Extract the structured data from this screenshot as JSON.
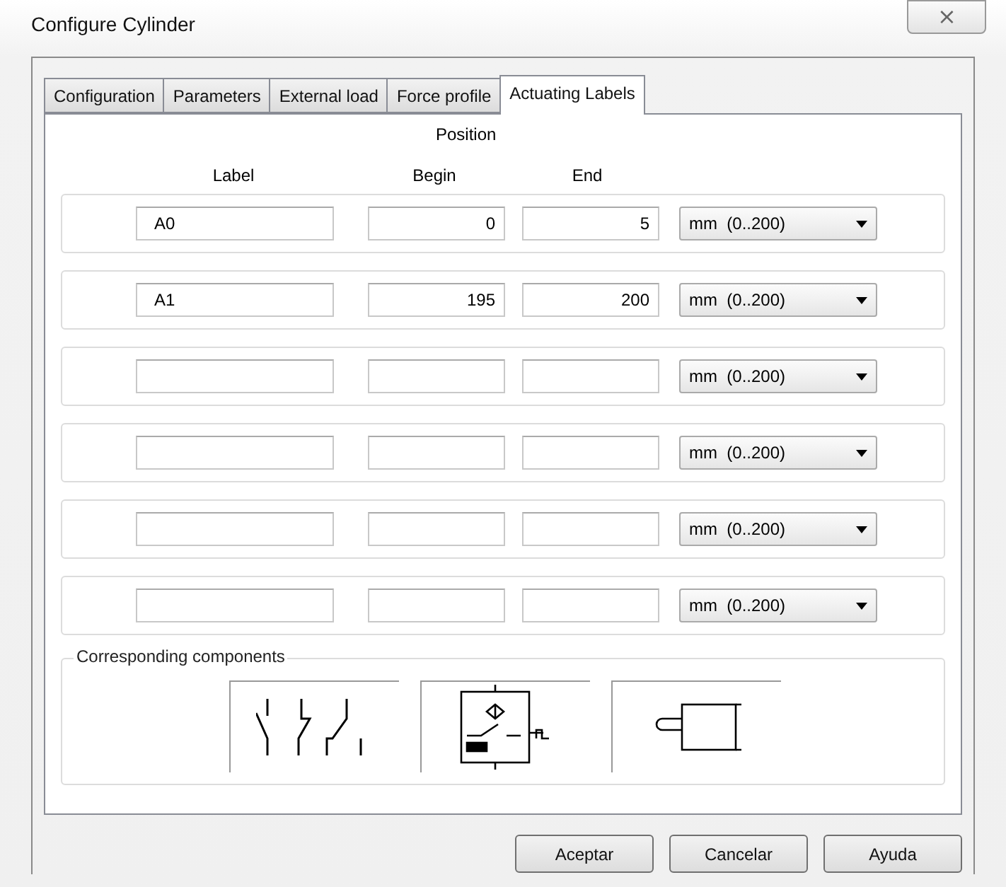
{
  "window": {
    "title": "Configure Cylinder",
    "close": "⨯"
  },
  "tabs": [
    {
      "label": "Configuration",
      "selected": false
    },
    {
      "label": "Parameters",
      "selected": false
    },
    {
      "label": "External load",
      "selected": false
    },
    {
      "label": "Force profile",
      "selected": false
    },
    {
      "label": "Actuating Labels",
      "selected": true
    }
  ],
  "headers": {
    "position": "Position",
    "label": "Label",
    "begin": "Begin",
    "end": "End"
  },
  "rows": [
    {
      "label": "A0",
      "begin": "0",
      "end": "5",
      "unit": "mm  (0..200)"
    },
    {
      "label": "A1",
      "begin": "195",
      "end": "200",
      "unit": "mm  (0..200)"
    },
    {
      "label": "",
      "begin": "",
      "end": "",
      "unit": "mm  (0..200)"
    },
    {
      "label": "",
      "begin": "",
      "end": "",
      "unit": "mm  (0..200)"
    },
    {
      "label": "",
      "begin": "",
      "end": "",
      "unit": "mm  (0..200)"
    },
    {
      "label": "",
      "begin": "",
      "end": "",
      "unit": "mm  (0..200)"
    }
  ],
  "components": {
    "title": "Corresponding components",
    "items": [
      {
        "kind": "switches"
      },
      {
        "kind": "sensor"
      },
      {
        "kind": "cylinder"
      }
    ]
  },
  "buttons": [
    "Aceptar",
    "Cancelar",
    "Ayuda"
  ]
}
